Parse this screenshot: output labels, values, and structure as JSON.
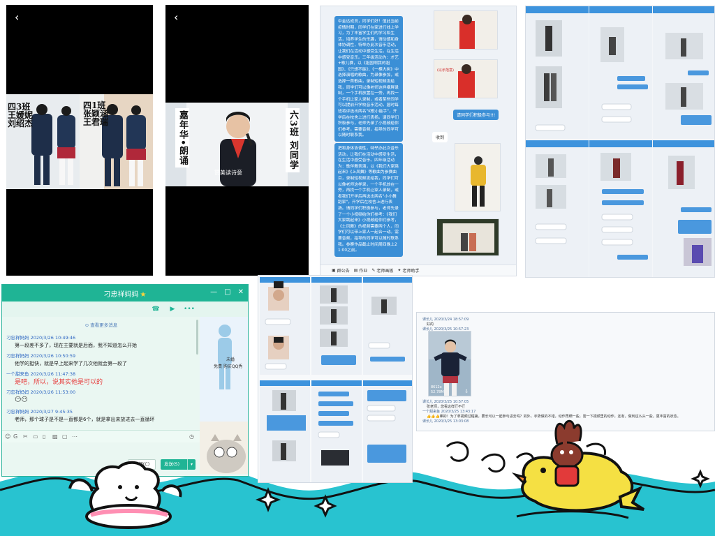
{
  "phone_left": {
    "back_glyph": "‹",
    "label_left": [
      "四3班",
      "王媛妮",
      "刘绍杰"
    ],
    "label_right": [
      "四1班",
      "张颖涵",
      "王君瑞"
    ]
  },
  "phone_mid": {
    "back_glyph": "‹",
    "left_banner": "嘉年华•朗诵",
    "right_banner": "六3班 刘同学",
    "subtitle": "赞美读诗意"
  },
  "notice": {
    "text_1": "中金达成员，同学们好！值此当前疫情时期，同学们在家进行线上学习，为了丰富学生们的学习和生活，培养学生的乐趣，请动感和身体协调性，特举办此次音乐活动，让我们在活动中感受生活，在生活中感受音乐。三年级活动为：才艺+歌儿赛，以《祖国啊我的祖国》、《只想不能》、《一棵大树》中选择演唱的歌曲，为录像参加，或选择一首歌曲，录制短视频发给我，同学们可以像老师这样横屏录制，一个手机放置在一旁，再找一个手机让家人录制，或者某些同学可以提前开学校音乐活动，届时每班将评选出两名\"K歌小能手\"，开学后在校舍上进行表扬。请同学们积极参与，老师先录了小视频给你们参考。需要音频，指导的同学可以随时联系我。",
    "text_2": "把和身体协调性，特举办此次音乐活动，让我们在活动中感受生活，在生活中感受音乐。四年级活动为：歌伴舞表演，以《我们大家跳起来》《上凤舞》等歌曲为参赛曲目，录制短视频发给我，同学们可以像老师这样录，一个手机放在一旁，再找一个手机让家人录制，或者我们开学后再选出两名\"小小舞蹈家\"，开学后在校舍上进行表扬。请同学们积极参与，老师先录了一个小视频给你们参考：《我们大家跳起来》小视频给你们参考，《土风舞》的视频需要两个人，同学们可以带上家人一起合一动。需要音频，指导的同学可以随时联系我。参赛作品截止时间周四晚上21:00之前。",
    "reply_please": "请同学们积极参与!!!",
    "reply_received": "收到",
    "bottom_items": [
      "群公告",
      "作业",
      "老师画板",
      "老师助手"
    ]
  },
  "qq": {
    "title": "刁忠祥妈妈",
    "title_star": "★",
    "window_buttons": [
      "—",
      "□",
      "✕"
    ],
    "more_link": "查看更多消息",
    "messages": [
      {
        "sender": "刁忠祥妈妈  2020/3/26 10:49:46",
        "text": "第一段差不多了，现在主要就是后面，我不知道怎么开始",
        "red": false
      },
      {
        "sender": "刁忠祥妈妈  2020/3/26 10:50:59",
        "text": "他学的挺快，就是早上起来学了几次他就会第一段了",
        "red": false
      },
      {
        "sender": "一个甜来鱼  2020/3/26 11:47:38",
        "text": "是吧，所以，说其实他是可以的",
        "red": true
      },
      {
        "sender": "刁忠祥妈妈  2020/3/26 11:53:00",
        "text": "😶😶",
        "red": false
      },
      {
        "sender": "刁忠祥妈妈  2020/3/27 9:45:35",
        "text": "老师，那个球子是不是一直都是6个，就是拿出来放进去一直循环",
        "red": false
      }
    ],
    "side_text_1": "未婚",
    "side_text_2": "免费  购买QQ秀",
    "close_label": "关闭(C)",
    "send_label": "发送(S)"
  },
  "log": {
    "line_1": "课长儿  2020/3/24 18:57:09",
    "line_1_text": "好的",
    "line_2": "课长儿  2020/3/25 10:57:23",
    "video_size": "8612x",
    "video_time": "52.78M",
    "line_3": "课长儿  2020/3/25 10:57:05",
    "line_3_text": "张老师，您看这样行不行",
    "line_4": "一个甜来鱼  2020/3/25 13:43:17",
    "line_4_text": "👍👍👍棒的！为了拿视频过程第，要长可以一起参与进去吗？另外，手势做的不错，动作再细一些，需一下视频里的动作，还有，做到这么头一些，更丰富的状态。",
    "line_5": "课长儿  2020/3/25 13:03:08"
  }
}
